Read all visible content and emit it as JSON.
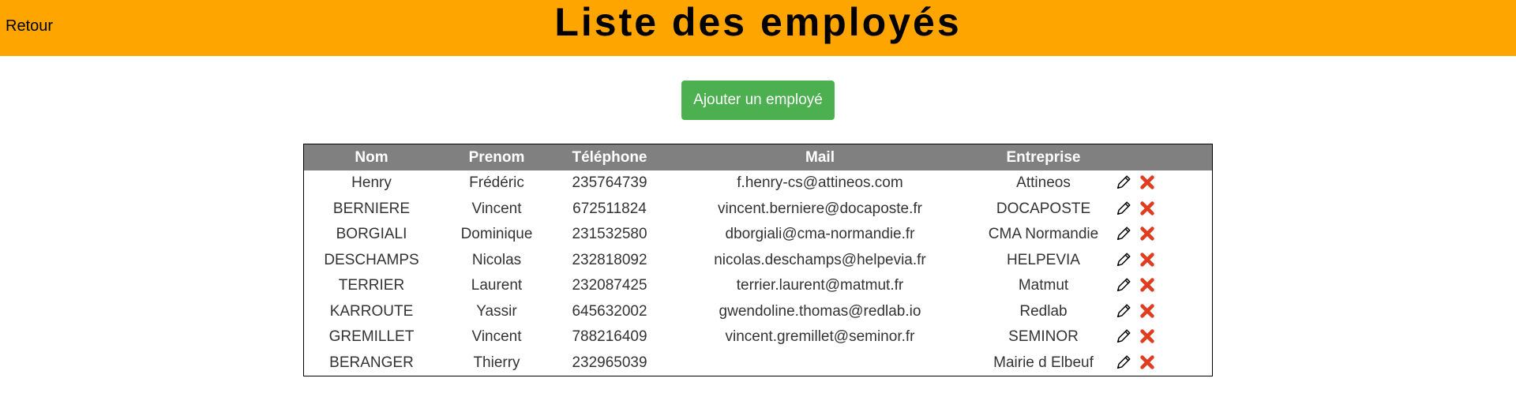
{
  "header": {
    "back_label": "Retour",
    "title": "Liste des employés"
  },
  "actions": {
    "add_label": "Ajouter un employé"
  },
  "table": {
    "columns": [
      "Nom",
      "Prenom",
      "Téléphone",
      "Mail",
      "Entreprise"
    ],
    "rows": [
      {
        "nom": "Henry",
        "prenom": "Frédéric",
        "telephone": "235764739",
        "mail": "f.henry-cs@attineos.com",
        "entreprise": "Attineos"
      },
      {
        "nom": "BERNIERE",
        "prenom": "Vincent",
        "telephone": "672511824",
        "mail": "vincent.berniere@docaposte.fr",
        "entreprise": "DOCAPOSTE"
      },
      {
        "nom": "BORGIALI",
        "prenom": "Dominique",
        "telephone": "231532580",
        "mail": "dborgiali@cma-normandie.fr",
        "entreprise": "CMA Normandie"
      },
      {
        "nom": "DESCHAMPS",
        "prenom": "Nicolas",
        "telephone": "232818092",
        "mail": "nicolas.deschamps@helpevia.fr",
        "entreprise": "HELPEVIA"
      },
      {
        "nom": "TERRIER",
        "prenom": "Laurent",
        "telephone": "232087425",
        "mail": "terrier.laurent@matmut.fr",
        "entreprise": "Matmut"
      },
      {
        "nom": "KARROUTE",
        "prenom": "Yassir",
        "telephone": "645632002",
        "mail": "gwendoline.thomas@redlab.io",
        "entreprise": "Redlab"
      },
      {
        "nom": "GREMILLET",
        "prenom": "Vincent",
        "telephone": "788216409",
        "mail": "vincent.gremillet@seminor.fr",
        "entreprise": "SEMINOR"
      },
      {
        "nom": "BERANGER",
        "prenom": "Thierry",
        "telephone": "232965039",
        "mail": "",
        "entreprise": "Mairie d Elbeuf"
      }
    ],
    "row_actions": [
      "pencil-icon",
      "delete-x-icon"
    ]
  },
  "colors": {
    "header_bg": "#ffa500",
    "add_button_bg": "#4caf50",
    "table_header_bg": "#808080",
    "delete_icon": "#e03c1f"
  }
}
